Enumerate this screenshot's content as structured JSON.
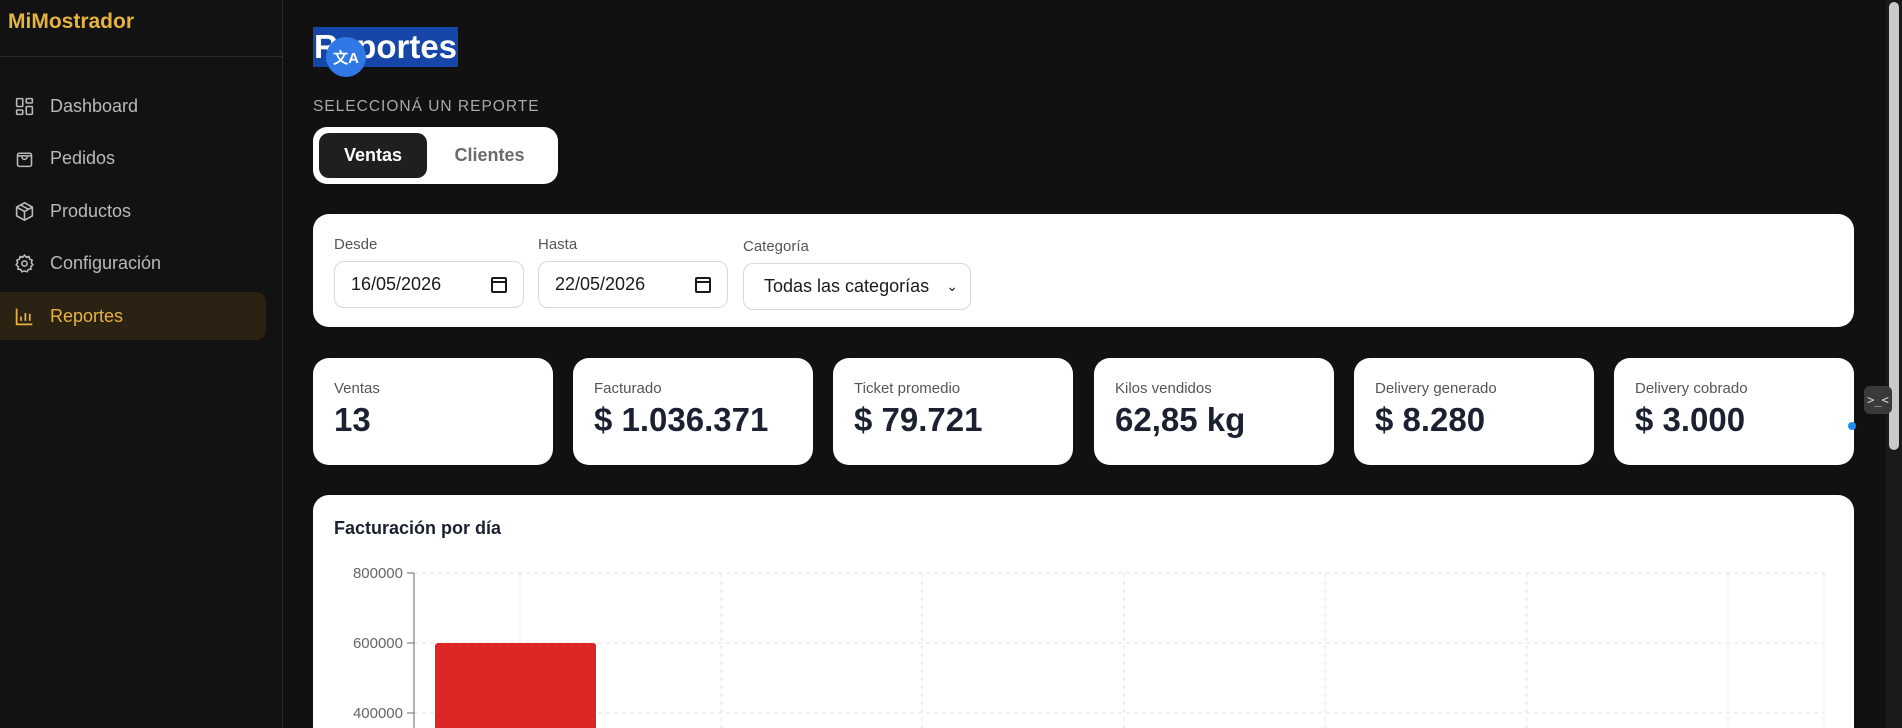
{
  "app": {
    "brand": "MiMostrador"
  },
  "sidebar": {
    "items": [
      {
        "label": "Dashboard",
        "icon": "dashboard-icon"
      },
      {
        "label": "Pedidos",
        "icon": "shopping-bag-icon"
      },
      {
        "label": "Productos",
        "icon": "box-icon"
      },
      {
        "label": "Configuración",
        "icon": "gear-icon"
      },
      {
        "label": "Reportes",
        "icon": "bar-chart-icon",
        "active": true
      }
    ]
  },
  "page": {
    "title": "Reportes",
    "translate_badge": "文A",
    "section_label": "SELECCIONÁ UN REPORTE",
    "tabs": [
      {
        "label": "Ventas",
        "active": true
      },
      {
        "label": "Clientes",
        "active": false
      }
    ]
  },
  "filters": {
    "desde_label": "Desde",
    "desde_value": "16/05/2026",
    "hasta_label": "Hasta",
    "hasta_value": "22/05/2026",
    "categoria_label": "Categoría",
    "categoria_value": "Todas las categorías"
  },
  "kpis": [
    {
      "label": "Ventas",
      "value": "13"
    },
    {
      "label": "Facturado",
      "value": "$ 1.036.371"
    },
    {
      "label": "Ticket promedio",
      "value": "$ 79.721"
    },
    {
      "label": "Kilos vendidos",
      "value": "62,85 kg"
    },
    {
      "label": "Delivery generado",
      "value": "$ 8.280"
    },
    {
      "label": "Delivery cobrado",
      "value": "$ 3.000"
    }
  ],
  "chart_data": {
    "type": "bar",
    "title": "Facturación por día",
    "ytick_labels": [
      "800000",
      "600000",
      "400000"
    ],
    "bar_color": "#dc2626",
    "bar_visible_values": [
      600000
    ]
  },
  "colors": {
    "accent": "#e6b33f",
    "bar": "#dc2626",
    "selection": "#1646a8"
  },
  "misc": {
    "devtools_widget": ">_<"
  }
}
